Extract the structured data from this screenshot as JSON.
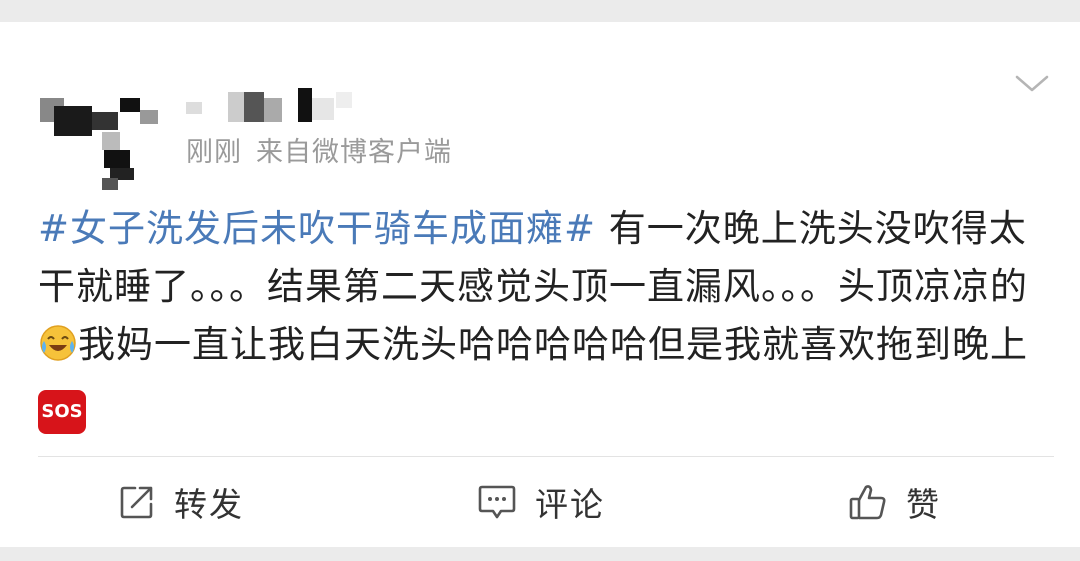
{
  "post": {
    "time": "刚刚",
    "source": "来自微博客户端",
    "hashtag": "#女子洗发后未吹干骑车成面瘫#",
    "text_part1": " 有一次晚上洗头没吹得太干就睡了。。。结果第二天感觉头顶一直漏风。。。头顶凉凉的",
    "text_part2": "我妈一直让我白天洗头哈哈哈哈哈但是我就喜欢拖到晚上",
    "emoji_1": "crying-laughing-emoji",
    "emoji_2": "sos-emoji",
    "sos_label": "SOS"
  },
  "actions": {
    "repost": "转发",
    "comment": "评论",
    "like": "赞"
  },
  "colors": {
    "hashtag": "#4a7ab8",
    "text": "#222222",
    "meta": "#9a9a9a",
    "sos": "#d7141a"
  }
}
